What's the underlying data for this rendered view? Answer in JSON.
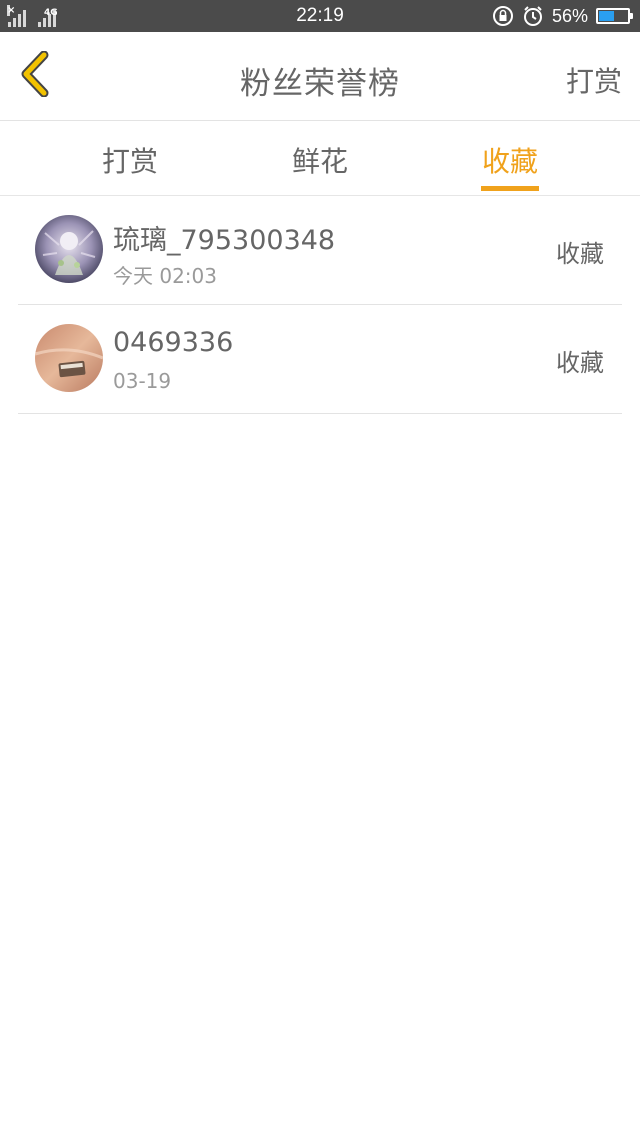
{
  "status_bar": {
    "network": "4G",
    "time": "22:19",
    "battery_percent": "56%",
    "battery_level": 0.56,
    "icons": [
      "signal-icon",
      "lock-rotation-icon",
      "alarm-icon",
      "battery-icon"
    ]
  },
  "nav": {
    "title": "粉丝荣誉榜",
    "action_label": "打赏",
    "back_icon": "chevron-left-icon",
    "back_color": "#f2c200"
  },
  "tabs": [
    {
      "label": "打赏",
      "active": false
    },
    {
      "label": "鲜花",
      "active": false
    },
    {
      "label": "收藏",
      "active": true
    }
  ],
  "accent_color": "#f0a21c",
  "list": [
    {
      "name": "琉璃_795300348",
      "time": "今天 02:03",
      "action": "收藏"
    },
    {
      "name": "0469336",
      "time": "03-19",
      "action": "收藏"
    }
  ]
}
